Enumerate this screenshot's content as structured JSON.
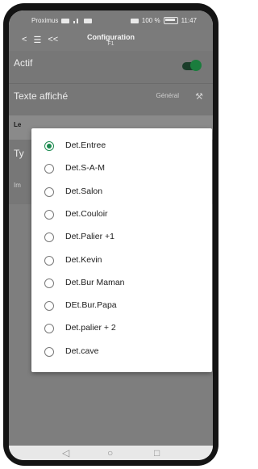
{
  "status_bar": {
    "carrier": "Proximus",
    "battery_text": "100 %",
    "time": "11:47"
  },
  "app_bar": {
    "nav_back": "<",
    "nav_menu": "☰",
    "nav_double_back": "<<",
    "title": "Configuration",
    "subtitle": "F1"
  },
  "settings": {
    "actif_label": "Actif",
    "texte_label": "Texte affiché",
    "texte_value": "Général",
    "le_label": "Le",
    "ty_label": "Ty",
    "im_label": "Im"
  },
  "dialog": {
    "selected_index": 0,
    "options": [
      "Det.Entree",
      "Det.S-A-M",
      "Det.Salon",
      "Det.Couloir",
      "Det.Palier +1",
      "Det.Kevin",
      "Det.Bur Maman",
      "DEt.Bur.Papa",
      "Det.palier + 2",
      "Det.cave"
    ]
  },
  "navbar": {
    "back": "◁",
    "home": "○",
    "recent": "□"
  },
  "colors": {
    "accent_green": "#1b8a4f",
    "overlay_grey": "#777777"
  }
}
